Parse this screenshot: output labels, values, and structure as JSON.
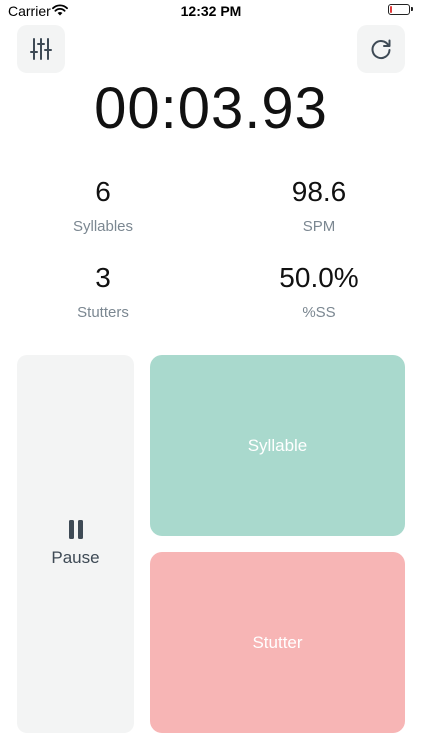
{
  "status_bar": {
    "carrier": "Carrier",
    "time": "12:32 PM",
    "battery_level": 0.1,
    "battery_color": "#e23b3b"
  },
  "toolbar": {
    "settings_icon": "sliders-icon",
    "reset_icon": "refresh-icon"
  },
  "timer": {
    "value": "00:03.93"
  },
  "stats": {
    "syllables": {
      "value": "6",
      "label": "Syllables"
    },
    "spm": {
      "value": "98.6",
      "label": "SPM"
    },
    "stutters": {
      "value": "3",
      "label": "Stutters"
    },
    "percent_ss": {
      "value": "50.0%",
      "label": "%SS"
    }
  },
  "controls": {
    "pause_label": "Pause",
    "syllable_label": "Syllable",
    "stutter_label": "Stutter",
    "syllable_color": "#a9d9cd",
    "stutter_color": "#f7b5b5"
  }
}
